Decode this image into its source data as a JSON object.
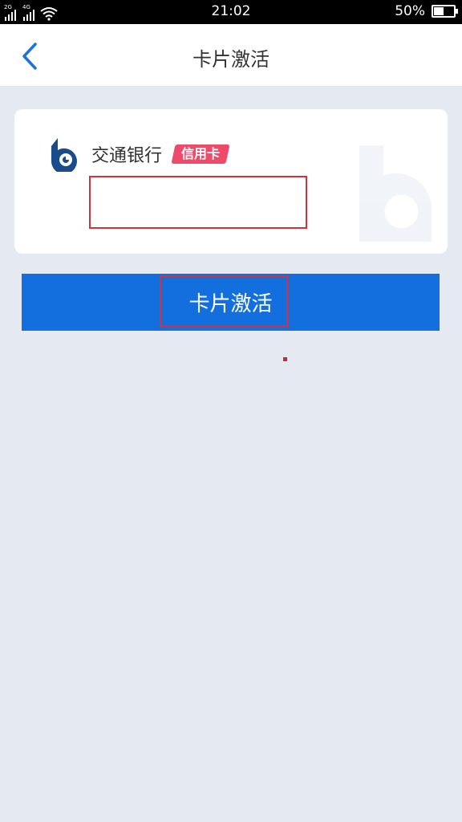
{
  "status_bar": {
    "signal_1_tag": "2G",
    "signal_2_tag": "4G",
    "time": "21:02",
    "battery_text": "50%",
    "battery_level": 0.5
  },
  "nav": {
    "back_icon": "chevron-left-icon",
    "title": "卡片激活"
  },
  "card": {
    "bank_logo": "bocom-logo-icon",
    "bank_name": "交通银行",
    "badge": "信用卡",
    "card_number_value": ""
  },
  "actions": {
    "activate_label": "卡片激活"
  },
  "colors": {
    "primary": "#136fdd",
    "background": "#e4e9f2",
    "badge": "#ee4a6a",
    "highlight": "#d3313c",
    "logo": "#1a4c8b"
  }
}
